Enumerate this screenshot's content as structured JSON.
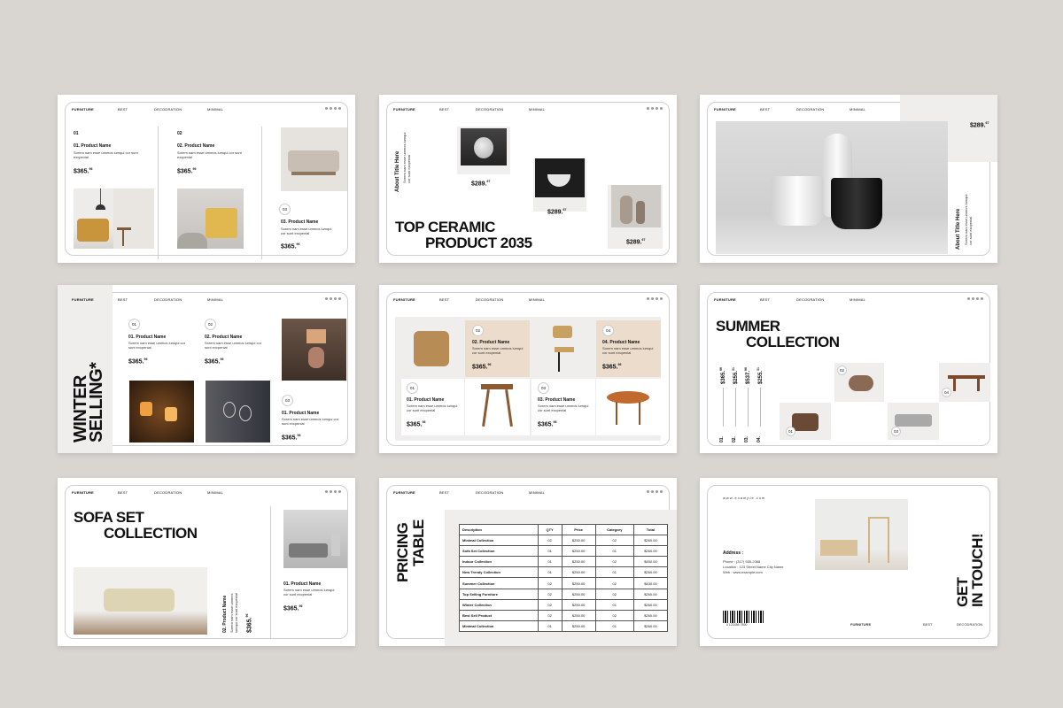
{
  "nav": {
    "furniture": "FURNITURE",
    "best": "BEST",
    "decoration": "DECODRATION",
    "minimal": "MINIMAL"
  },
  "lorem": "Sorem nam esse ummos iumqui cor sunt excpenial",
  "product": "Product Name",
  "price": "$365.",
  "cents": "96",
  "s1": {
    "n1": "01",
    "n2": "02",
    "n3": "03",
    "p1": "01. Product Name",
    "p2": "02. Product Name",
    "p3": "03. Product Name"
  },
  "s2": {
    "about": "About Title Here",
    "title1": "TOP CERAMIC",
    "title2": "PRODUCT 2035",
    "price": "$289.",
    "cents": "67"
  },
  "s3": {
    "price": "$289.",
    "cents": "67",
    "about": "About Title Here"
  },
  "s4": {
    "t1": "WINTER",
    "t2": "SELLING*",
    "n1": "01",
    "n2": "02",
    "n3": "03",
    "p1": "01. Product Name",
    "p2": "02. Product Name",
    "p3": "01. Product Name"
  },
  "s5": {
    "n1": "01",
    "n2": "02",
    "n3": "03",
    "n4": "04",
    "p1": "01. Product Name",
    "p2": "02. Product Name",
    "p3": "03. Product Name",
    "p4": "04. Product Name"
  },
  "s6": {
    "t1": "SUMMER",
    "t2": "COLLECTION",
    "prices": [
      "$365.",
      "$255.",
      "$537.",
      "$255."
    ],
    "cents": [
      "96",
      "31",
      "96",
      "31"
    ],
    "nums": [
      "01.",
      "02.",
      "03.",
      "04."
    ],
    "labels": [
      "01",
      "02",
      "03",
      "04"
    ]
  },
  "s7": {
    "t1": "SOFA SET",
    "t2": "COLLECTION",
    "p1": "01. Product Name",
    "p2": "02. Product Name"
  },
  "s8": {
    "t1": "PRICING",
    "t2": "TABLE",
    "headers": [
      "Description",
      "QTY",
      "Price",
      "Category",
      "Total"
    ],
    "rows": [
      [
        "Minimal Collection",
        "02",
        "$250.00",
        "02",
        "$260.00"
      ],
      [
        "Sofa Set Collection",
        "01",
        "$250.00",
        "01",
        "$260.00"
      ],
      [
        "Indoor Collection",
        "01",
        "$250.00",
        "02",
        "$450.00"
      ],
      [
        "New Trendy Collection",
        "01",
        "$250.00",
        "01",
        "$260.00"
      ],
      [
        "Summer Collection",
        "02",
        "$250.00",
        "02",
        "$430.00"
      ],
      [
        "Top Selling Furniture",
        "02",
        "$250.00",
        "02",
        "$260.00"
      ],
      [
        "Winter Collection",
        "02",
        "$250.00",
        "01",
        "$260.00"
      ],
      [
        "Best Sell Product",
        "02",
        "$250.00",
        "02",
        "$260.00"
      ],
      [
        "Minimal Collection",
        "01",
        "$250.00",
        "01",
        "$260.00"
      ]
    ]
  },
  "s9": {
    "website": "www.example.com",
    "address": "Address :",
    "phone": "Phone : (317) 555-2368",
    "location": "Location : 123 Street Name City Name",
    "web": "Web : www.example.com",
    "get": "GET",
    "touch": "IN TOUCH!",
    "barcode": "0 123456 7890",
    "f1": "FURNITURE",
    "f2": "BEST",
    "f3": "DECODRATION"
  },
  "colors": {
    "background": "#d9d6d2",
    "slide": "#ffffff",
    "beige": "#ecdccb",
    "grey": "#efeeec"
  }
}
